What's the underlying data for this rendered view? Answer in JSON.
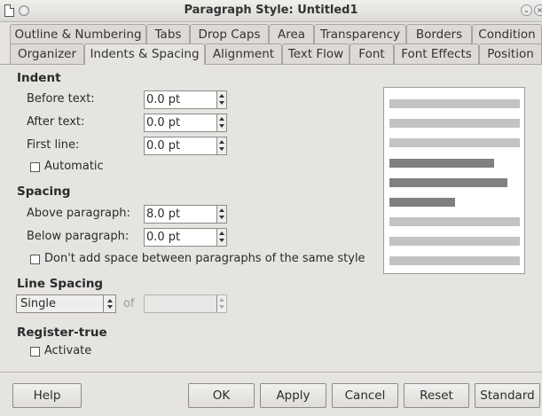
{
  "window": {
    "title": "Paragraph Style: Untitled1"
  },
  "tabs": {
    "row1": [
      "Outline & Numbering",
      "Tabs",
      "Drop Caps",
      "Area",
      "Transparency",
      "Borders",
      "Condition"
    ],
    "row2": [
      "Organizer",
      "Indents & Spacing",
      "Alignment",
      "Text Flow",
      "Font",
      "Font Effects",
      "Position"
    ],
    "active": "Indents & Spacing"
  },
  "indent": {
    "title": "Indent",
    "before_label": "Before text:",
    "before_value": "0.0 pt",
    "after_label": "After text:",
    "after_value": "0.0 pt",
    "first_label": "First line:",
    "first_value": "0.0 pt",
    "automatic_label": "Automatic",
    "automatic_checked": false
  },
  "spacing": {
    "title": "Spacing",
    "above_label": "Above paragraph:",
    "above_value": "8.0 pt",
    "below_label": "Below paragraph:",
    "below_value": "0.0 pt",
    "dont_add_label": "Don't add space between paragraphs of the same style",
    "dont_add_checked": false
  },
  "line_spacing": {
    "title": "Line Spacing",
    "selected": "Single",
    "of_label": "of",
    "of_value": ""
  },
  "register_true": {
    "title": "Register-true",
    "activate_label": "Activate",
    "activate_checked": false
  },
  "preview": {
    "colors": {
      "light": "#c3c3c3",
      "dark": "#808080"
    }
  },
  "buttons": {
    "help": "Help",
    "ok": "OK",
    "apply": "Apply",
    "cancel": "Cancel",
    "reset": "Reset",
    "standard": "Standard"
  }
}
